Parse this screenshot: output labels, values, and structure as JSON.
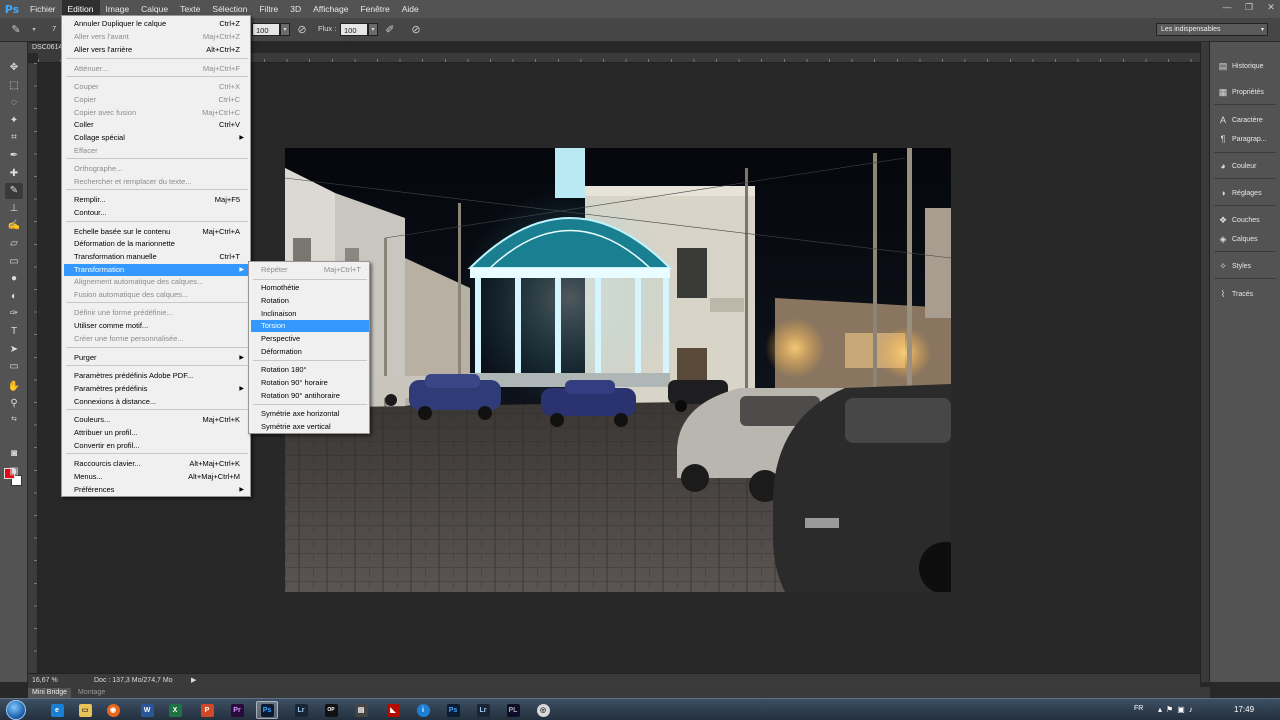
{
  "menubar": {
    "logo": "Ps",
    "items": [
      "Fichier",
      "Edition",
      "Image",
      "Calque",
      "Texte",
      "Sélection",
      "Filtre",
      "3D",
      "Affichage",
      "Fenêtre",
      "Aide"
    ],
    "active_index": 1
  },
  "window_controls": {
    "minimize": "—",
    "restore": "❐",
    "close": "✕"
  },
  "options_bar": {
    "brush_size": "7",
    "opacity_value": "100 %",
    "flow_label": "Flux :",
    "flow_value": "100 %",
    "workspace": "Les indispensables"
  },
  "document": {
    "tab_title": "DSC0614"
  },
  "edit_menu": {
    "items": [
      {
        "label": "Annuler Dupliquer le calque",
        "shortcut": "Ctrl+Z",
        "disabled": false
      },
      {
        "label": "Aller vers l'avant",
        "shortcut": "Maj+Ctrl+Z",
        "disabled": true
      },
      {
        "label": "Aller vers l'arrière",
        "shortcut": "Alt+Ctrl+Z",
        "disabled": false
      },
      {
        "label": "Atténuer...",
        "shortcut": "Maj+Ctrl+F",
        "disabled": true
      },
      {
        "label": "Couper",
        "shortcut": "Ctrl+X",
        "disabled": true
      },
      {
        "label": "Copier",
        "shortcut": "Ctrl+C",
        "disabled": true
      },
      {
        "label": "Copier avec fusion",
        "shortcut": "Maj+Ctrl+C",
        "disabled": true
      },
      {
        "label": "Coller",
        "shortcut": "Ctrl+V",
        "disabled": false
      },
      {
        "label": "Collage spécial",
        "shortcut": "",
        "disabled": false,
        "submenu": true
      },
      {
        "label": "Effacer",
        "shortcut": "",
        "disabled": true
      },
      {
        "label": "Orthographe...",
        "shortcut": "",
        "disabled": true
      },
      {
        "label": "Rechercher et remplacer du texte...",
        "shortcut": "",
        "disabled": true
      },
      {
        "label": "Remplir...",
        "shortcut": "Maj+F5",
        "disabled": false
      },
      {
        "label": "Contour...",
        "shortcut": "",
        "disabled": false
      },
      {
        "label": "Echelle basée sur le contenu",
        "shortcut": "Maj+Ctrl+A",
        "disabled": false
      },
      {
        "label": "Déformation de la marionnette",
        "shortcut": "",
        "disabled": false
      },
      {
        "label": "Transformation manuelle",
        "shortcut": "Ctrl+T",
        "disabled": false
      },
      {
        "label": "Transformation",
        "shortcut": "",
        "disabled": false,
        "submenu": true,
        "highlighted": true
      },
      {
        "label": "Alignement automatique des calques...",
        "shortcut": "",
        "disabled": true
      },
      {
        "label": "Fusion automatique des calques...",
        "shortcut": "",
        "disabled": true
      },
      {
        "label": "Définir une forme prédéfinie...",
        "shortcut": "",
        "disabled": true
      },
      {
        "label": "Utiliser comme motif...",
        "shortcut": "",
        "disabled": false
      },
      {
        "label": "Créer une forme personnalisée...",
        "shortcut": "",
        "disabled": true
      },
      {
        "label": "Purger",
        "shortcut": "",
        "disabled": false,
        "submenu": true
      },
      {
        "label": "Paramètres prédéfinis Adobe PDF...",
        "shortcut": "",
        "disabled": false
      },
      {
        "label": "Paramètres prédéfinis",
        "shortcut": "",
        "disabled": false,
        "submenu": true
      },
      {
        "label": "Connexions à distance...",
        "shortcut": "",
        "disabled": false
      },
      {
        "label": "Couleurs...",
        "shortcut": "Maj+Ctrl+K",
        "disabled": false
      },
      {
        "label": "Attribuer un profil...",
        "shortcut": "",
        "disabled": false
      },
      {
        "label": "Convertir en profil...",
        "shortcut": "",
        "disabled": false
      },
      {
        "label": "Raccourcis clavier...",
        "shortcut": "Alt+Maj+Ctrl+K",
        "disabled": false
      },
      {
        "label": "Menus...",
        "shortcut": "Alt+Maj+Ctrl+M",
        "disabled": false
      },
      {
        "label": "Préférences",
        "shortcut": "",
        "disabled": false,
        "submenu": true
      }
    ]
  },
  "transform_menu": {
    "items": [
      {
        "label": "Répéter",
        "shortcut": "Maj+Ctrl+T",
        "disabled": true
      },
      {
        "label": "Homothétie",
        "shortcut": "",
        "disabled": false
      },
      {
        "label": "Rotation",
        "shortcut": "",
        "disabled": false
      },
      {
        "label": "Inclinaison",
        "shortcut": "",
        "disabled": false
      },
      {
        "label": "Torsion",
        "shortcut": "",
        "disabled": false,
        "highlighted": true
      },
      {
        "label": "Perspective",
        "shortcut": "",
        "disabled": false
      },
      {
        "label": "Déformation",
        "shortcut": "",
        "disabled": false
      },
      {
        "label": "Rotation 180°",
        "shortcut": "",
        "disabled": false
      },
      {
        "label": "Rotation 90° horaire",
        "shortcut": "",
        "disabled": false
      },
      {
        "label": "Rotation 90° antihoraire",
        "shortcut": "",
        "disabled": false
      },
      {
        "label": "Symétrie axe horizontal",
        "shortcut": "",
        "disabled": false
      },
      {
        "label": "Symétrie axe vertical",
        "shortcut": "",
        "disabled": false
      }
    ]
  },
  "right_panel": {
    "items": [
      {
        "label": "Historique",
        "icon": "history-icon"
      },
      {
        "label": "Propriétés",
        "icon": "properties-icon"
      },
      {
        "label": "Caractère",
        "icon": "character-icon"
      },
      {
        "label": "Paragrap...",
        "icon": "paragraph-icon"
      },
      {
        "label": "Couleur",
        "icon": "color-icon"
      },
      {
        "label": "Réglages",
        "icon": "adjustments-icon"
      },
      {
        "label": "Couches",
        "icon": "channels-icon"
      },
      {
        "label": "Calques",
        "icon": "layers-icon"
      },
      {
        "label": "Styles",
        "icon": "styles-icon"
      },
      {
        "label": "Tracés",
        "icon": "paths-icon"
      }
    ]
  },
  "status_bar": {
    "zoom": "16,67 %",
    "doc_info": "Doc : 137,3 Mo/274,7 Mo"
  },
  "bridge_tabs": [
    "Mini Bridge",
    "Montage"
  ],
  "taskbar": {
    "language": "FR",
    "clock": "17:49"
  },
  "colors": {
    "foreground": "#e30613",
    "background": "#ffffff",
    "menu_highlight": "#3399ff"
  }
}
